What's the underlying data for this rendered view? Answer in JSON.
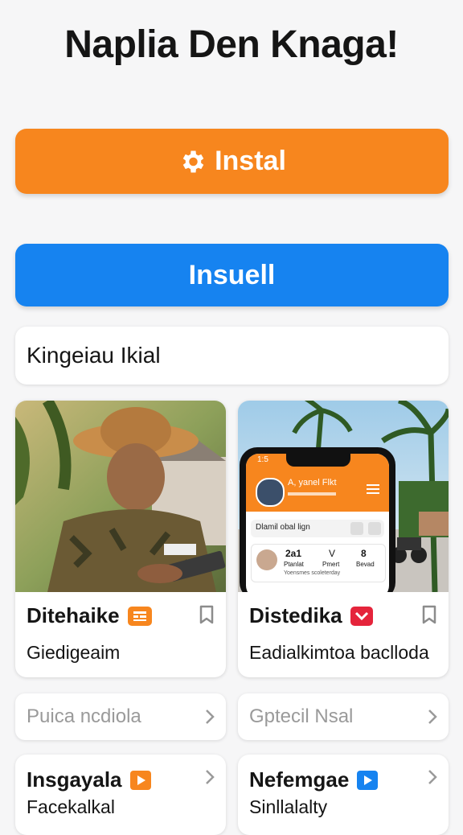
{
  "header": {
    "title": "Naplia Den Knaga!"
  },
  "buttons": {
    "install_label": "Instal",
    "insuell_label": "Insuell"
  },
  "search": {
    "value": "Kingeiau Ikial"
  },
  "cards": [
    {
      "title": "Ditehaike",
      "subtitle": "Giedigeaim",
      "badge_icon": "calendar-icon",
      "badge_color": "#f7861e"
    },
    {
      "title": "Distedika",
      "subtitle": "Eadialkimtoa baclloda",
      "badge_icon": "mail-icon",
      "badge_color": "#e5243b"
    }
  ],
  "phone": {
    "name": "A, yanel Flkt",
    "status_time": "1:5",
    "search_text": "Dlamil obal lign",
    "stats": [
      "2a1",
      "V",
      "8"
    ],
    "stat_labels": [
      "Ptanlat",
      "Pmert",
      "Bevad"
    ],
    "footer_text": "Yoensmes scoleterday"
  },
  "pills": [
    {
      "label": "Puica ncdiola"
    },
    {
      "label": "Gptecil Nsal"
    }
  ],
  "bottom_cards": [
    {
      "title": "Insgayala",
      "subtitle": "Facekalkal",
      "icon": "play-icon",
      "icon_color": "#f7861e"
    },
    {
      "title": "Nefemgae",
      "subtitle": "Sinllalalty",
      "icon": "play-icon",
      "icon_color": "#1683f0"
    }
  ],
  "colors": {
    "orange": "#f7861e",
    "blue": "#1683f0",
    "red": "#e5243b"
  }
}
